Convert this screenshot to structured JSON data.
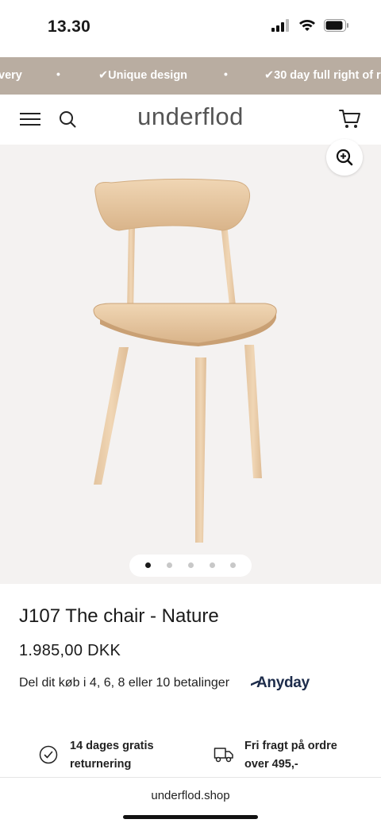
{
  "status_bar": {
    "time": "13.30",
    "icons": [
      "signal-icon",
      "wifi-icon",
      "battery-icon"
    ]
  },
  "announcement": {
    "items": [
      "very",
      "✔Unique design",
      "✔30 day full right of re"
    ],
    "separator": "•",
    "background_color": "#b9ada1"
  },
  "header": {
    "logo": "underflod",
    "icons": [
      "menu-icon",
      "search-icon",
      "cart-icon"
    ]
  },
  "gallery": {
    "image": "chair-image",
    "slide_count": 5,
    "active_slide": 1,
    "zoom_icon": "zoom-in-icon"
  },
  "product": {
    "title": "J107 The chair - Nature",
    "price": "1.985,00 DKK",
    "installments_text": "Del dit køb i 4, 6, 8 eller 10 betalinger",
    "payment_provider": "Anyday"
  },
  "usps": [
    {
      "icon": "check-circle-icon",
      "line1": "14 dages gratis",
      "line2": "returnering"
    },
    {
      "icon": "delivery-truck-icon",
      "line1": "Fri fragt på ordre",
      "line2": "over 495,-"
    }
  ],
  "browser": {
    "url": "underflod.shop"
  }
}
